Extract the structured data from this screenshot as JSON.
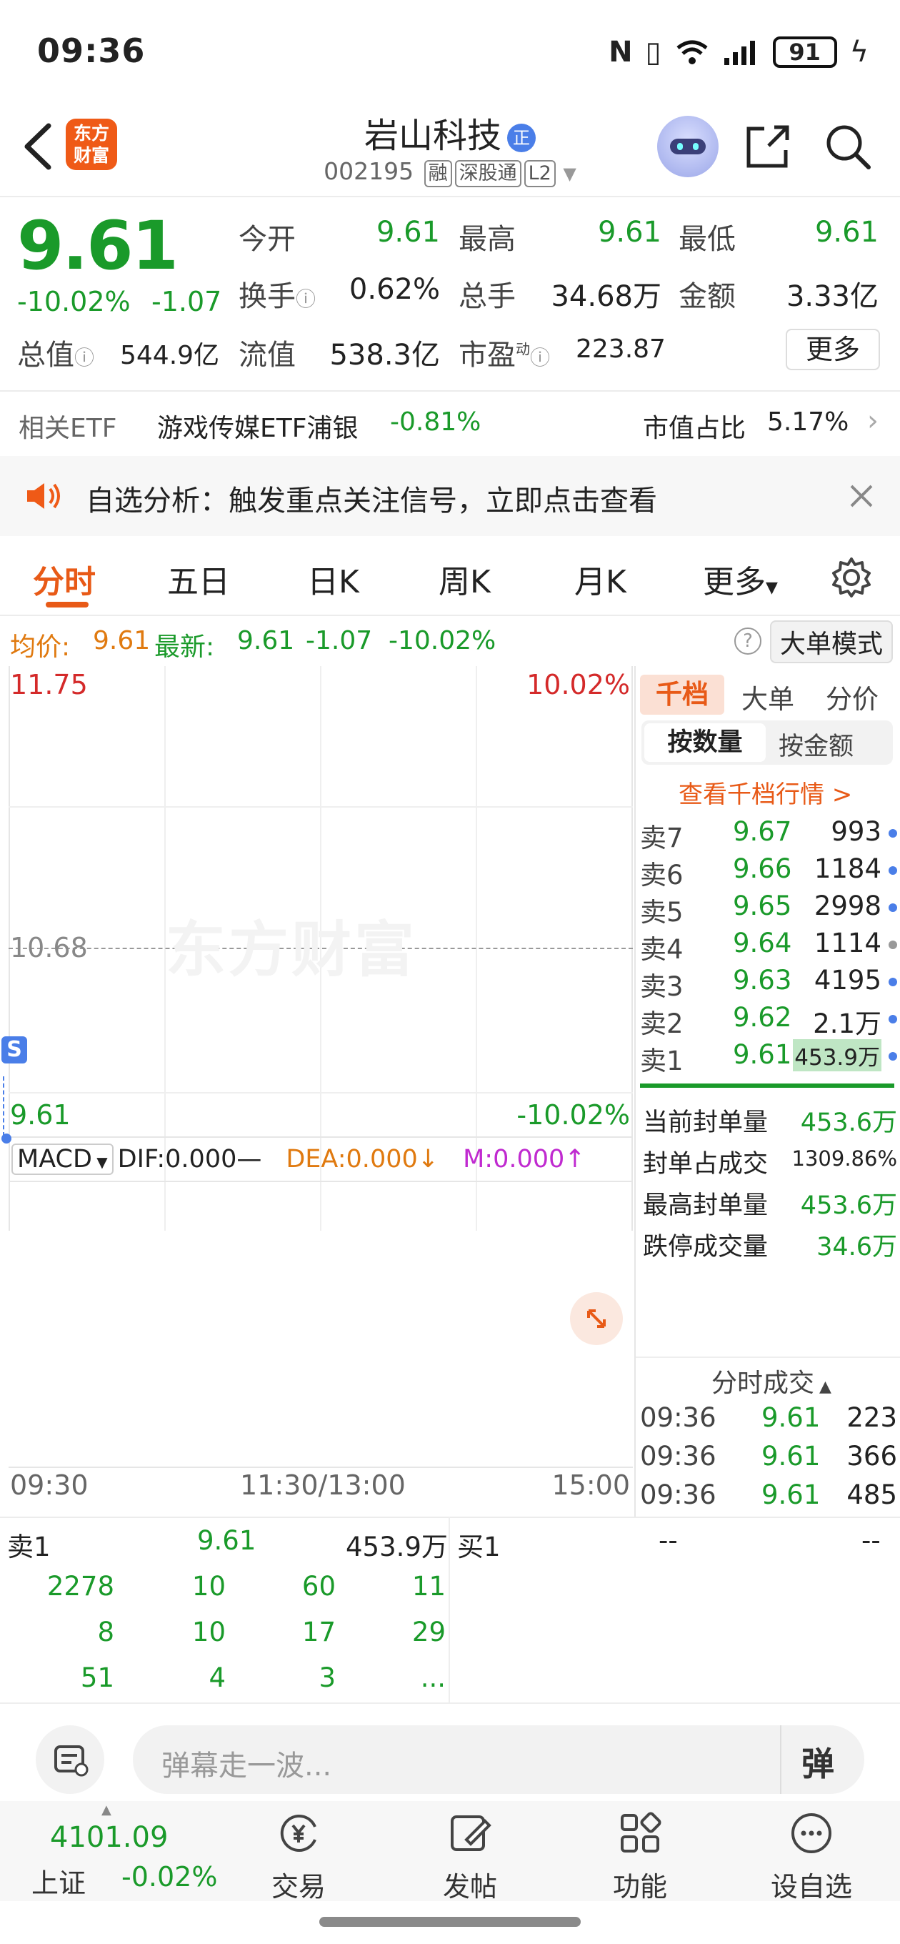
{
  "status_bar": {
    "time": "09:36",
    "battery": "91"
  },
  "header": {
    "logo_line1": "东方",
    "logo_line2": "财富",
    "stock_name": "岩山科技",
    "name_badge": "正",
    "code": "002195",
    "tags": [
      "融",
      "深股通",
      "L2"
    ]
  },
  "quote": {
    "price": "9.61",
    "change_pct": "-10.02%",
    "change": "-1.07",
    "open_label": "今开",
    "open": "9.61",
    "high_label": "最高",
    "high": "9.61",
    "low_label": "最低",
    "low": "9.61",
    "turnover_label": "换手",
    "turnover": "0.62%",
    "volume_label": "总手",
    "volume": "34.68万",
    "amount_label": "金额",
    "amount": "3.33亿",
    "mktcap_label": "总值",
    "mktcap": "544.9亿",
    "float_label": "流值",
    "float_cap": "538.3亿",
    "pe_label": "市盈",
    "pe_sup": "动",
    "pe": "223.87",
    "more_label": "更多"
  },
  "etf": {
    "label": "相关ETF",
    "name": "游戏传媒ETF浦银",
    "pct": "-0.81%",
    "ratio_label": "市值占比",
    "ratio": "5.17%"
  },
  "notice": {
    "text": "自选分析：触发重点关注信号，立即点击查看"
  },
  "tabs": [
    "分时",
    "五日",
    "日K",
    "周K",
    "月K",
    "更多"
  ],
  "info_line": {
    "avg_label": "均价:",
    "avg": "9.61",
    "latest_label": "最新:",
    "latest": "9.61",
    "change": "-1.07",
    "pct": "-10.02%",
    "big_order_mode": "大单模式"
  },
  "chart": {
    "y_top": "11.75",
    "y_top_pct": "10.02%",
    "y_mid": "10.68",
    "y_bottom": "9.61",
    "y_bottom_pct": "-10.02%",
    "watermark": "东方财富",
    "s_marker": "S",
    "x_start": "09:30",
    "x_mid": "11:30/13:00",
    "x_end": "15:00",
    "macd_label": "MACD",
    "dif": "DIF:0.000—",
    "dea": "DEA:0.000↓",
    "m": "M:0.000↑"
  },
  "order_book": {
    "tabs": [
      "千档",
      "大单",
      "分价"
    ],
    "subtabs": [
      "按数量",
      "按金额"
    ],
    "link": "查看千档行情 >",
    "asks": [
      {
        "label": "卖7",
        "price": "9.67",
        "vol": "993"
      },
      {
        "label": "卖6",
        "price": "9.66",
        "vol": "1184"
      },
      {
        "label": "卖5",
        "price": "9.65",
        "vol": "2998"
      },
      {
        "label": "卖4",
        "price": "9.64",
        "vol": "1114"
      },
      {
        "label": "卖3",
        "price": "9.63",
        "vol": "4195"
      },
      {
        "label": "卖2",
        "price": "9.62",
        "vol": "2.1万"
      },
      {
        "label": "卖1",
        "price": "9.61",
        "vol": "453.9万"
      }
    ],
    "seal": [
      {
        "label": "当前封单量",
        "value": "453.6万"
      },
      {
        "label": "封单占成交",
        "value": "1309.86%"
      },
      {
        "label": "最高封单量",
        "value": "453.6万"
      },
      {
        "label": "跌停成交量",
        "value": "34.6万"
      }
    ],
    "trades_title": "分时成交",
    "trades": [
      {
        "time": "09:36",
        "price": "9.61",
        "vol": "223"
      },
      {
        "time": "09:36",
        "price": "9.61",
        "vol": "366"
      },
      {
        "time": "09:36",
        "price": "9.61",
        "vol": "485"
      }
    ]
  },
  "book": {
    "sell1_label": "卖1",
    "sell1_price": "9.61",
    "sell1_vol": "453.9万",
    "buy1_label": "买1",
    "buy1_price": "--",
    "buy1_vol": "--",
    "queue": [
      [
        "2278",
        "10",
        "60",
        "11"
      ],
      [
        "8",
        "10",
        "17",
        "29"
      ],
      [
        "51",
        "4",
        "3",
        "..."
      ]
    ]
  },
  "comment": {
    "placeholder": "弹幕走一波...",
    "danmu_label": "弹"
  },
  "bottom_nav": {
    "index_value": "4101.09",
    "index_name": "上证",
    "index_pct": "-0.02%",
    "items": [
      "交易",
      "发帖",
      "功能",
      "设自选"
    ]
  }
}
